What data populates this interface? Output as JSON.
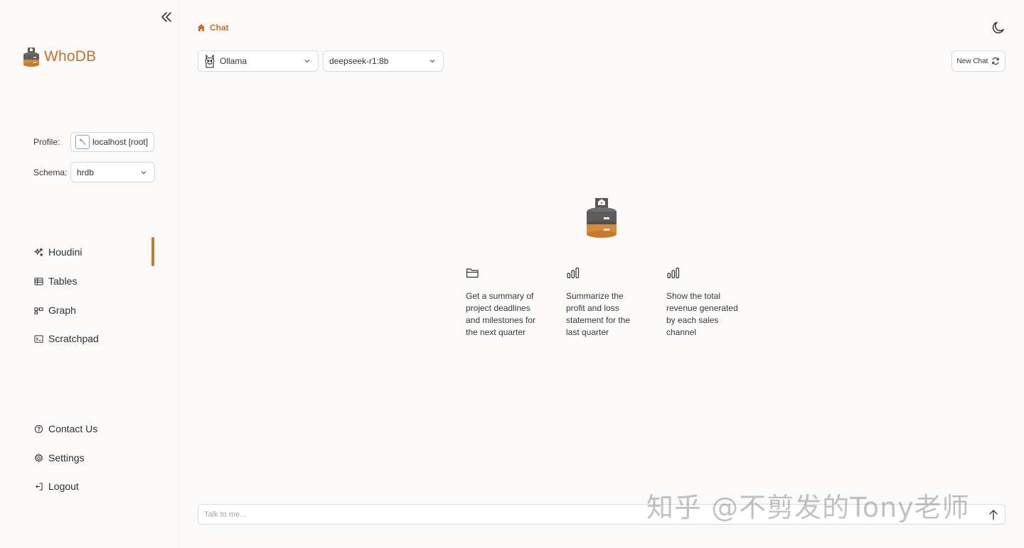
{
  "app": {
    "name": "WhoDB",
    "accent_color": "#c0722c"
  },
  "sidebar": {
    "profile": {
      "label": "Profile:",
      "value": "localhost [root]"
    },
    "schema": {
      "label": "Schema:",
      "value": "hrdb"
    },
    "nav_items": [
      {
        "label": "Houdini",
        "icon": "sparkles-icon",
        "active": true
      },
      {
        "label": "Tables",
        "icon": "table-icon"
      },
      {
        "label": "Graph",
        "icon": "graph-icon"
      },
      {
        "label": "Scratchpad",
        "icon": "terminal-icon"
      }
    ],
    "bottom_items": [
      {
        "label": "Contact Us",
        "icon": "help-circle-icon"
      },
      {
        "label": "Settings",
        "icon": "gear-icon"
      },
      {
        "label": "Logout",
        "icon": "logout-icon"
      }
    ]
  },
  "header": {
    "breadcrumb": "Chat"
  },
  "toolbar": {
    "provider": "Ollama",
    "model": "deepseek-r1:8b",
    "new_chat_label": "New Chat"
  },
  "suggestions": [
    {
      "icon": "folder-icon",
      "text": "Get a summary of project deadlines and milestones for the next quarter"
    },
    {
      "icon": "bar-chart-icon",
      "text": "Summarize the profit and loss statement for the last quarter"
    },
    {
      "icon": "bar-chart-icon",
      "text": "Show the total revenue generated by each sales channel"
    }
  ],
  "chat": {
    "placeholder": "Talk to me..."
  },
  "watermark": "知乎 @不剪发的Tony老师"
}
